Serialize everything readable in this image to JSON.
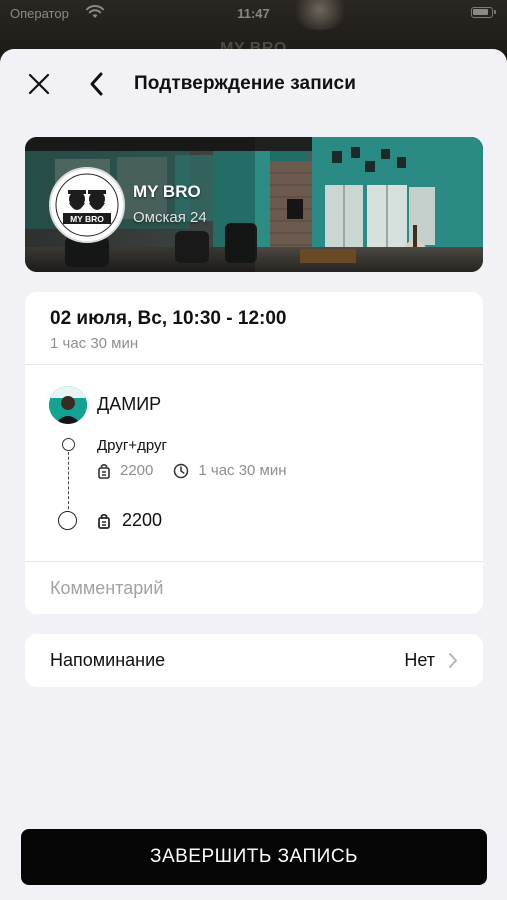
{
  "status_bar": {
    "carrier": "Оператор",
    "time": "11:47"
  },
  "behind_title": "MY BRO",
  "nav": {
    "title": "Подтверждение записи"
  },
  "salon": {
    "name": "MY BRO",
    "address": "Омская 24",
    "logo_text": "MY BRO"
  },
  "booking": {
    "datetime": "02 июля, Вс, 10:30 - 12:00",
    "duration": "1 час 30 мин",
    "master_name": "ДАМИР",
    "service": {
      "name": "Друг+друг",
      "price": "2200",
      "duration": "1 час 30 мин"
    },
    "total_price": "2200",
    "comment_placeholder": "Комментарий"
  },
  "reminder": {
    "label": "Напоминание",
    "value": "Нет"
  },
  "submit_label": "ЗАВЕРШИТЬ ЗАПИСЬ",
  "colors": {
    "sheet_background": "#f2f2f6",
    "card_background": "#ffffff",
    "primary_button": "#050505",
    "secondary_text": "#8e8e93"
  }
}
